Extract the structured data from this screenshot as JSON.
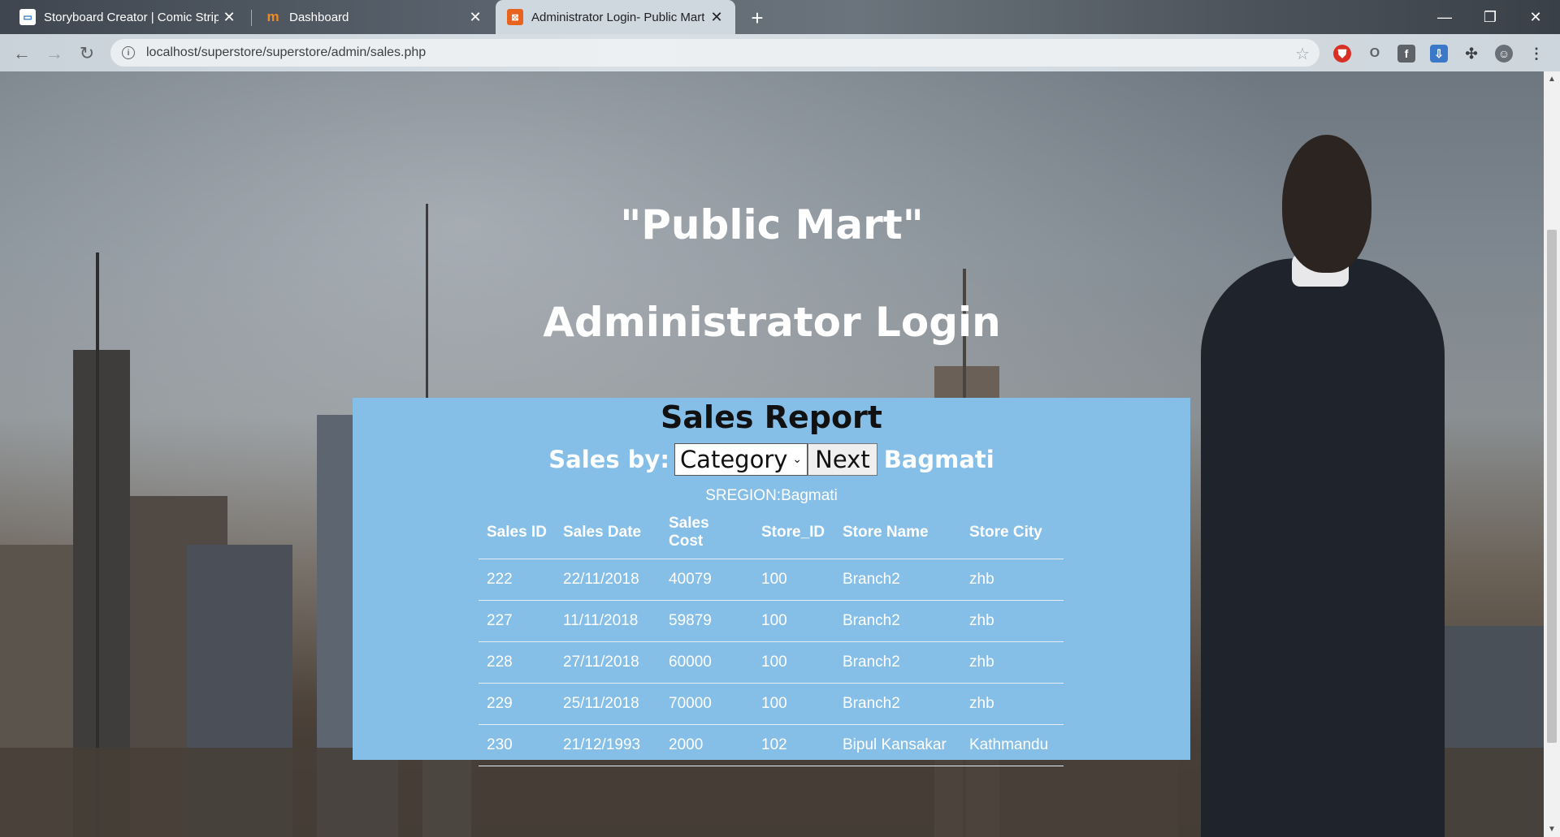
{
  "browser": {
    "tabs": [
      {
        "title": "Storyboard Creator | Comic Strip",
        "favicon": "storyboard-icon"
      },
      {
        "title": "Dashboard",
        "favicon": "moodle-icon"
      },
      {
        "title": "Administrator Login- Public Mart",
        "favicon": "xampp-icon"
      }
    ],
    "url": "localhost/superstore/superstore/admin/sales.php"
  },
  "page": {
    "brand": "\"Public Mart\"",
    "heading": "Administrator Login"
  },
  "report": {
    "title": "Sales Report",
    "sales_by_label": "Sales by:",
    "selected_option": "Category",
    "next_label": "Next",
    "region": "Bagmati",
    "sregion_text": "SREGION:Bagmati",
    "columns": [
      "Sales ID",
      "Sales Date",
      "Sales Cost",
      "Store_ID",
      "Store Name",
      "Store City"
    ],
    "rows": [
      [
        "222",
        "22/11/2018",
        "40079",
        "100",
        "Branch2",
        "zhb"
      ],
      [
        "227",
        "11/11/2018",
        "59879",
        "100",
        "Branch2",
        "zhb"
      ],
      [
        "228",
        "27/11/2018",
        "60000",
        "100",
        "Branch2",
        "zhb"
      ],
      [
        "229",
        "25/11/2018",
        "70000",
        "100",
        "Branch2",
        "zhb"
      ],
      [
        "230",
        "21/12/1993",
        "2000",
        "102",
        "Bipul Kansakar",
        "Kathmandu"
      ]
    ]
  },
  "colors": {
    "panel": "#85bfe8",
    "heading_text": "#ffffff"
  }
}
